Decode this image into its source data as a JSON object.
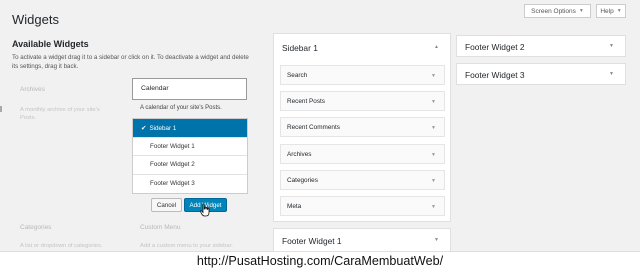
{
  "header": {
    "title": "Widgets",
    "screen_options": "Screen Options",
    "help": "Help"
  },
  "available": {
    "title": "Available Widgets",
    "description": "To activate a widget drag it to a sidebar or click on it. To deactivate a widget and delete its settings, drag it back.",
    "ghost_widgets": [
      {
        "title": "Archives",
        "desc": "A monthly archive of your site's Posts."
      },
      {
        "title": "Categories",
        "desc": "A list or dropdown of categories."
      },
      {
        "title": "Custom Menu",
        "desc": "Add a custom menu to your sidebar."
      }
    ],
    "calendar": {
      "title": "Calendar",
      "description": "A calendar of your site's Posts."
    },
    "chooser": {
      "options": [
        "Sidebar 1",
        "Footer Widget 1",
        "Footer Widget 2",
        "Footer Widget 3"
      ],
      "selected_index": 0,
      "cancel_label": "Cancel",
      "add_label": "Add Widget"
    }
  },
  "sidebars": {
    "sidebar_1": {
      "title": "Sidebar 1",
      "widgets": [
        "Search",
        "Recent Posts",
        "Recent Comments",
        "Archives",
        "Categories",
        "Meta"
      ]
    },
    "footer_1": {
      "title": "Footer Widget 1"
    },
    "footer_2": {
      "title": "Footer Widget 2"
    },
    "footer_3": {
      "title": "Footer Widget 3"
    }
  },
  "caption": "http://PusatHosting.com/CaraMembuatWeb/",
  "colors": {
    "accent": "#0073aa",
    "button_primary": "#0085ba",
    "background": "#f1f1f1"
  }
}
